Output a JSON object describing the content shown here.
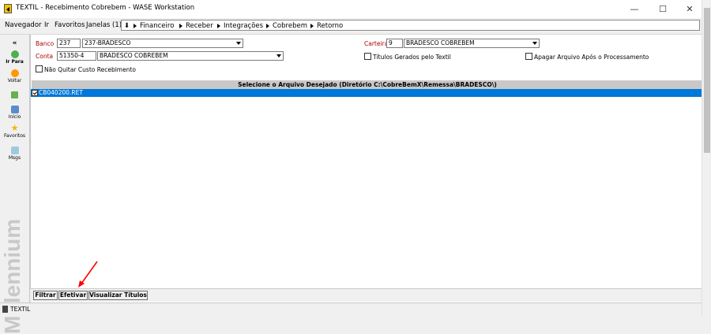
{
  "window": {
    "title": "TEXTIL - Recebimento Cobrebem - WASE Workstation",
    "controls": {
      "minimize": "—",
      "maximize": "☐",
      "close": "✕"
    }
  },
  "menu": {
    "items": [
      "Navegador",
      "Ir",
      "Favoritos",
      "Janelas (1)"
    ],
    "breadcrumb": [
      "Financeiro",
      "Receber",
      "Integrações",
      "Cobrebem",
      "Retorno"
    ]
  },
  "sidebar": {
    "collapse": "«",
    "buttons": [
      "Ir Para",
      "Voltar",
      "Início",
      "Favoritos",
      "Msgs"
    ],
    "brand": "Millennium"
  },
  "form": {
    "banco_label": "Banco",
    "banco_code": "237",
    "banco_name": "237-BRADESCO",
    "conta_label": "Conta",
    "conta_code": "51350-4",
    "conta_name": "BRADESCO COBREBEM",
    "carteira_label": "Carteira",
    "carteira_code": "9",
    "carteira_name": "BRADESCO COBREBEM",
    "nao_quitar_label": "Não Quitar Custo Recebimento",
    "titulos_gerados_label": "Títulos Gerados pelo Textil",
    "apagar_arquivo_label": "Apagar Arquivo Após o Processamento"
  },
  "file_list": {
    "header": "Selecione o Arquivo Desejado (Diretório C:\\CobreBemX\\Remessa\\BRADESCO\\)",
    "files": [
      {
        "name": "CB040200.RET",
        "checked": true
      }
    ]
  },
  "actions": {
    "filtrar": "Filtrar",
    "efetivar": "Efetivar",
    "visualizar": "Visualizar Títulos"
  },
  "status": {
    "text": "TEXTIL"
  },
  "colors": {
    "selection": "#0078d7",
    "label_red": "#b00000",
    "annotation_arrow": "#ff0000"
  }
}
